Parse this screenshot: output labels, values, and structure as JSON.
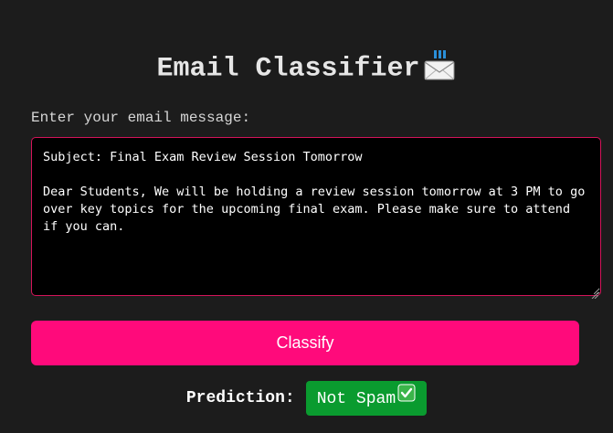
{
  "header": {
    "title": "Email Classifier",
    "title_icon": "envelope-with-arrow-icon"
  },
  "form": {
    "prompt_label": "Enter your email message:",
    "email_value": "Subject: Final Exam Review Session Tomorrow\n\nDear Students, We will be holding a review session tomorrow at 3 PM to go over key topics for the upcoming final exam. Please make sure to attend if you can.",
    "classify_label": "Classify"
  },
  "result": {
    "label": "Prediction:",
    "value": "Not Spam",
    "value_icon": "check-mark-icon"
  },
  "colors": {
    "background": "#1c1c1c",
    "accent": "#ff0a7b",
    "textarea_border": "#d4145a",
    "badge_green": "#0a9b2f"
  }
}
